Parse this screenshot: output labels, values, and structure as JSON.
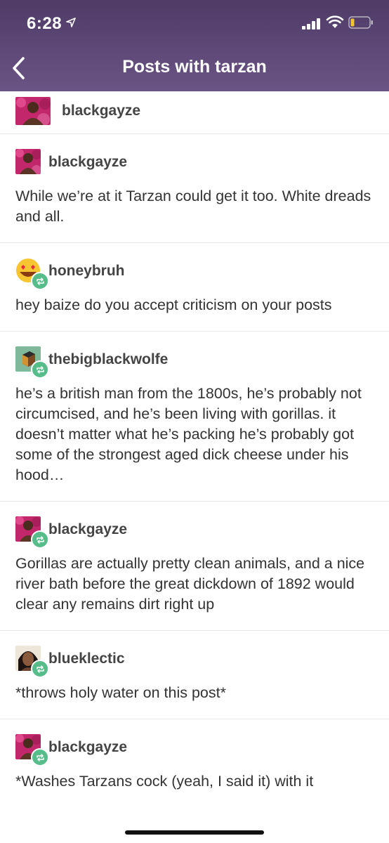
{
  "status_bar": {
    "time": "6:28"
  },
  "nav": {
    "title": "Posts with tarzan"
  },
  "posts": [
    {
      "username": "blackgayze",
      "avatar": "blackgayze",
      "reblog": false,
      "body": ""
    },
    {
      "username": "blackgayze",
      "avatar": "blackgayze",
      "reblog": false,
      "body": "While we’re at it Tarzan could get it too. White dreads and all."
    },
    {
      "username": "honeybruh",
      "avatar": "heart-eyes-emoji",
      "reblog": true,
      "body": "hey baize do you accept criticism on your posts"
    },
    {
      "username": "thebigblackwolfe",
      "avatar": "cube",
      "reblog": true,
      "body": "he’s a british man from the 1800s, he’s probably not circumcised, and he’s been living with gorillas. it doesn’t matter what he’s packing he’s probably got some of the strongest aged dick cheese under his hood…"
    },
    {
      "username": "blackgayze",
      "avatar": "blackgayze",
      "reblog": true,
      "body": "Gorillas are actually pretty clean animals, and a nice river bath before the great dickdown of 1892 would clear any remains dirt right up"
    },
    {
      "username": "blueklectic",
      "avatar": "portrait",
      "reblog": true,
      "body": "*throws holy water on this post*"
    },
    {
      "username": "blackgayze",
      "avatar": "blackgayze",
      "reblog": true,
      "body": "*Washes Tarzans cock (yeah, I said it) with it"
    }
  ],
  "colors": {
    "header_top": "#4f3b66",
    "header_bottom": "#6a5485",
    "reblog_green": "#56bc8a"
  }
}
